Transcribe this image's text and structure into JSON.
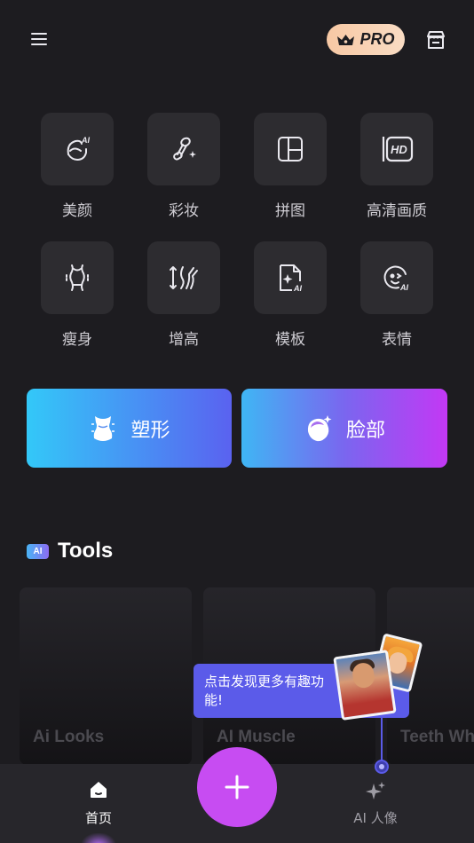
{
  "header": {
    "pro_label": "PRO"
  },
  "features": [
    {
      "label": "美颜",
      "icon": "ai-face-icon"
    },
    {
      "label": "彩妆",
      "icon": "makeup-brush-icon"
    },
    {
      "label": "拼图",
      "icon": "collage-icon"
    },
    {
      "label": "高清画质",
      "icon": "hd-icon"
    },
    {
      "label": "瘦身",
      "icon": "body-slim-icon"
    },
    {
      "label": "增高",
      "icon": "height-increase-icon"
    },
    {
      "label": "模板",
      "icon": "ai-template-icon"
    },
    {
      "label": "表情",
      "icon": "ai-expression-icon"
    }
  ],
  "hd_badge_text": "HD",
  "ai_badge_text": "AI",
  "big_buttons": {
    "shape_label": "塑形",
    "face_label": "脸部"
  },
  "tools": {
    "chip": "AI",
    "heading": "Tools",
    "cards": [
      {
        "label": "Ai Looks"
      },
      {
        "label": "AI Muscle"
      },
      {
        "label": "Teeth Wh"
      }
    ]
  },
  "tooltip": {
    "text": "点击发现更多有趣功能!"
  },
  "bottom_nav": {
    "home_label": "首页",
    "ai_label": "AI 人像"
  },
  "colors": {
    "background": "#1d1c20",
    "tile": "#2d2c30",
    "accent_purple": "#c74cf2",
    "tooltip": "#5b5be9",
    "pro_badge": "#f8d2b4"
  }
}
